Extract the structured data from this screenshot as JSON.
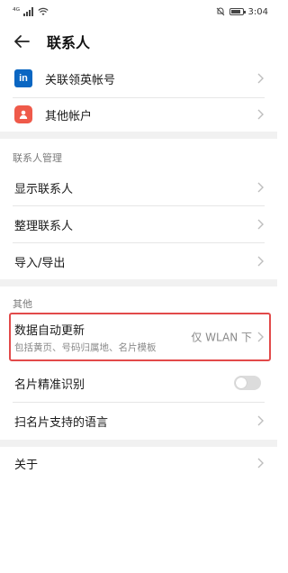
{
  "status_bar": {
    "signal": "⁴ᴳ",
    "time": "3:04"
  },
  "header": {
    "title": "联系人"
  },
  "accounts": [
    {
      "label": "关联领英帐号",
      "icon": "in"
    },
    {
      "label": "其他帐户",
      "icon": ""
    }
  ],
  "contacts_section": {
    "header": "联系人管理",
    "items": [
      {
        "label": "显示联系人"
      },
      {
        "label": "整理联系人"
      },
      {
        "label": "导入/导出"
      }
    ]
  },
  "other_section": {
    "header": "其他",
    "auto_update": {
      "label": "数据自动更新",
      "sublabel": "包括黄页、号码归属地、名片模板",
      "value": "仅 WLAN 下"
    },
    "card_recognition": {
      "label": "名片精准识别",
      "enabled": false
    },
    "card_languages": {
      "label": "扫名片支持的语言"
    }
  },
  "about": {
    "label": "关于"
  },
  "colors": {
    "accent": "#0a66c2",
    "highlight": "#e24a4a",
    "other_account": "#ef5a4a"
  }
}
